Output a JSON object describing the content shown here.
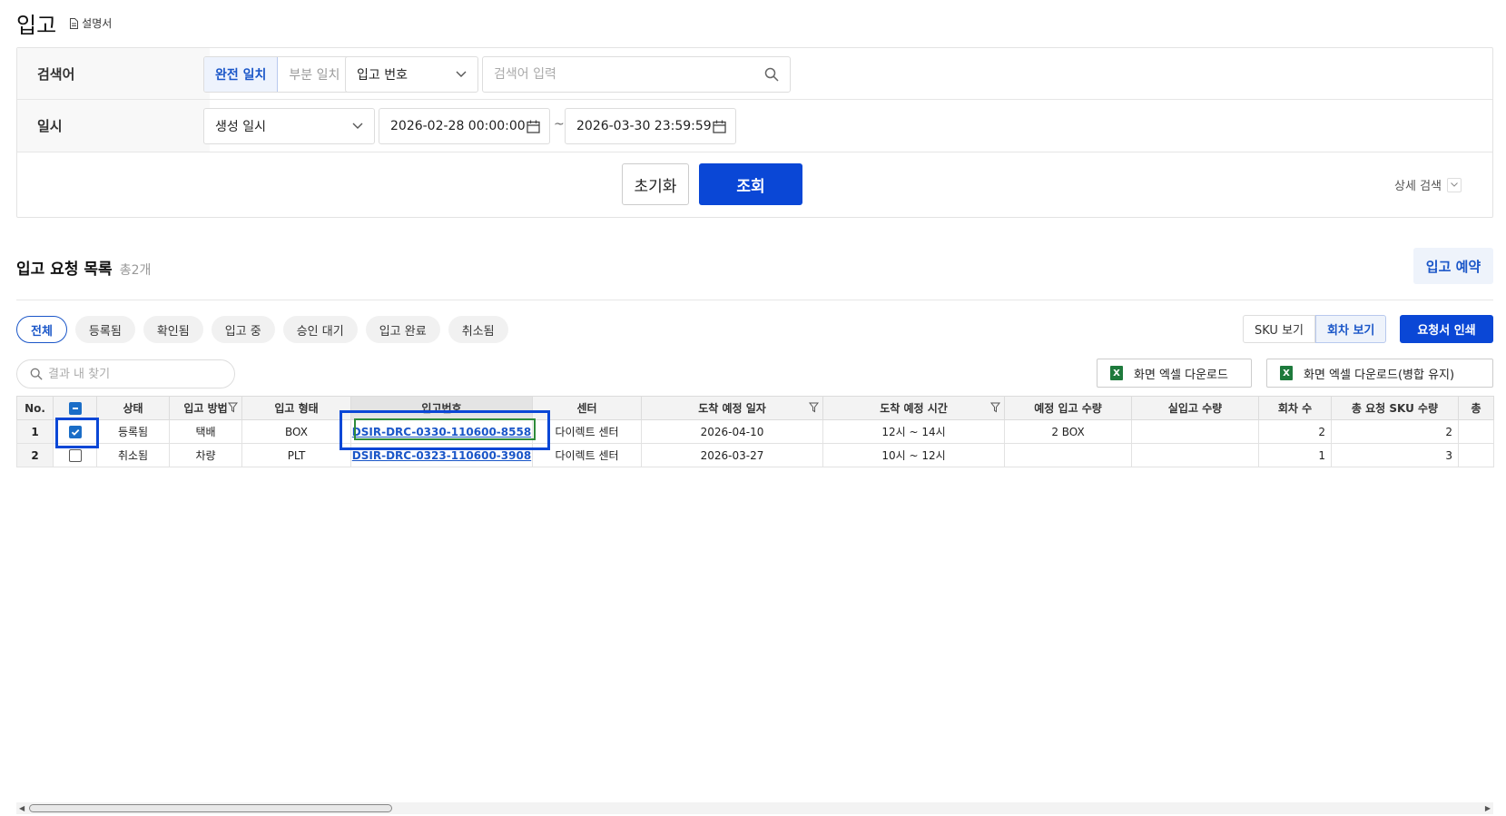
{
  "page": {
    "title": "입고",
    "manual_label": "설명서"
  },
  "search": {
    "keyword_label": "검색어",
    "match_exact": "완전 일치",
    "match_partial": "부분 일치",
    "field_select": "입고 번호",
    "keyword_placeholder": "검색어 입력",
    "date_label": "일시",
    "date_type_select": "생성 일시",
    "date_from": "2026-02-28 00:00:00",
    "date_sep": "~",
    "date_to": "2026-03-30 23:59:59",
    "reset_label": "초기화",
    "submit_label": "조회",
    "advanced_label": "상세 검색"
  },
  "list": {
    "title": "입고 요청 목록",
    "count": "총2개",
    "reserve_label": "입고 예약",
    "status_tabs": [
      "전체",
      "등록됨",
      "확인됨",
      "입고 중",
      "승인 대기",
      "입고 완료",
      "취소됨"
    ],
    "active_tab": "전체",
    "view_sku": "SKU 보기",
    "view_round": "회차 보기",
    "print_label": "요청서 인쇄",
    "result_search_placeholder": "결과 내 찾기",
    "excel_download": "화면 엑셀 다운로드",
    "excel_download_merge": "화면 엑셀 다운로드(병합 유지)"
  },
  "table": {
    "columns": [
      "No.",
      "",
      "상태",
      "입고 방법",
      "입고 형태",
      "입고번호",
      "센터",
      "도착 예정 일자",
      "도착 예정 시간",
      "예정 입고 수량",
      "실입고 수량",
      "회차 수",
      "총 요청 SKU 수량",
      "총"
    ],
    "rows": [
      {
        "no": "1",
        "checked": true,
        "status": "등록됨",
        "method": "택배",
        "type": "BOX",
        "number": "DSIR-DRC-0330-110600-8558",
        "center": "다이렉트 센터",
        "arrival_date": "2026-04-10",
        "arrival_time": "12시 ~ 14시",
        "expected_qty": "2 BOX",
        "actual_qty": "",
        "rounds": "2",
        "sku_qty": "2"
      },
      {
        "no": "2",
        "checked": false,
        "status": "취소됨",
        "method": "차량",
        "type": "PLT",
        "number": "DSIR-DRC-0323-110600-3908",
        "center": "다이렉트 센터",
        "arrival_date": "2026-03-27",
        "arrival_time": "10시 ~ 12시",
        "expected_qty": "",
        "actual_qty": "",
        "rounds": "1",
        "sku_qty": "3"
      }
    ]
  },
  "colors": {
    "primary": "#0a47d6",
    "link": "#1a56c8",
    "excel_green": "#1e7a3c",
    "highlight_inner": "#2e8b3a"
  }
}
